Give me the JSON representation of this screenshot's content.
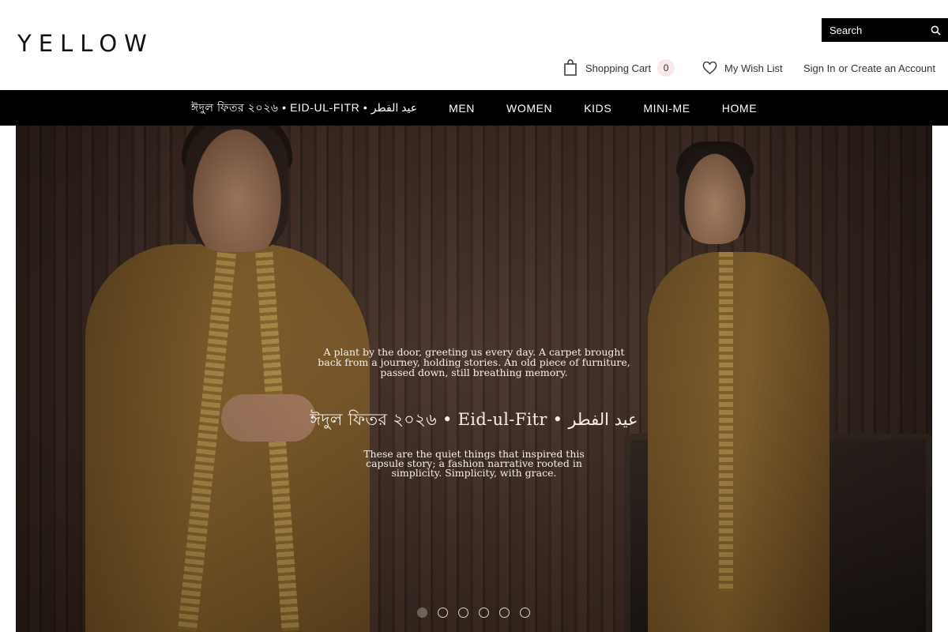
{
  "header": {
    "logo": "YELLOW",
    "search": {
      "placeholder": "Search",
      "icon": "search-icon"
    },
    "cart": {
      "label": "Shopping Cart",
      "count": "0",
      "icon": "shopping-bag-icon"
    },
    "wishlist": {
      "label": "My Wish List",
      "icon": "heart-icon"
    },
    "account": {
      "sign_in": "Sign In",
      "or": "or",
      "create": "Create an Account"
    }
  },
  "nav": {
    "items": [
      {
        "label": "ঈদুল ফিতর ২০২৬ • EID-UL-FITR • عيد الفطر"
      },
      {
        "label": "MEN"
      },
      {
        "label": "WOMEN"
      },
      {
        "label": "KIDS"
      },
      {
        "label": "MINI-ME"
      },
      {
        "label": "HOME"
      }
    ]
  },
  "hero": {
    "intro_lines": [
      "A plant by the door, greeting us every day. A carpet brought",
      "back from a journey, holding stories. An old piece of furniture,",
      "passed down, still breathing memory."
    ],
    "headline": "ঈদুল ফিতর ২০২৬ • Eid-ul-Fitr • عيد الفطر",
    "outro_lines": [
      "These are the quiet things that inspired this",
      "capsule story; a fashion narrative rooted in",
      "simplicity. Simplicity, with grace."
    ],
    "slides": {
      "count": 6,
      "active": 1
    }
  },
  "colors": {
    "nav_bg": "#000000",
    "cart_badge_bg": "#f9e7ea",
    "hero_text": "#f4efe6"
  }
}
